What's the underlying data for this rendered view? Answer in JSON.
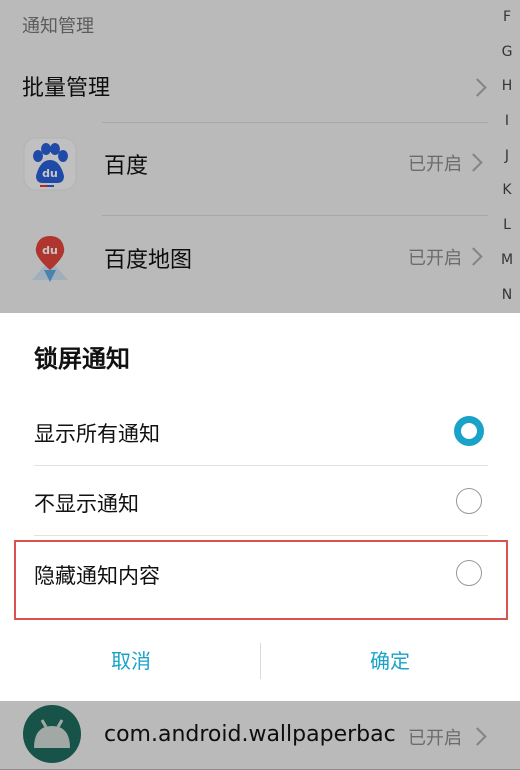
{
  "background": {
    "section_title": "通知管理",
    "batch_label": "批量管理",
    "apps": [
      {
        "name": "百度",
        "status": "已开启",
        "icon": "baidu-paw-icon"
      },
      {
        "name": "百度地图",
        "status": "已开启",
        "icon": "baidu-map-pin-icon"
      }
    ],
    "bottom_app": {
      "name": "com.android.wallpaperbac",
      "status": "已开启",
      "icon": "android-robot-icon"
    },
    "alpha_index": [
      "F",
      "G",
      "H",
      "I",
      "J",
      "K",
      "L",
      "M",
      "N"
    ]
  },
  "dialog": {
    "title": "锁屏通知",
    "options": [
      {
        "label": "显示所有通知",
        "selected": true
      },
      {
        "label": "不显示通知",
        "selected": false
      },
      {
        "label": "隐藏通知内容",
        "selected": false
      }
    ],
    "cancel_label": "取消",
    "confirm_label": "确定"
  },
  "colors": {
    "accent": "#1aa3c8",
    "highlight_border": "#d9534f"
  }
}
